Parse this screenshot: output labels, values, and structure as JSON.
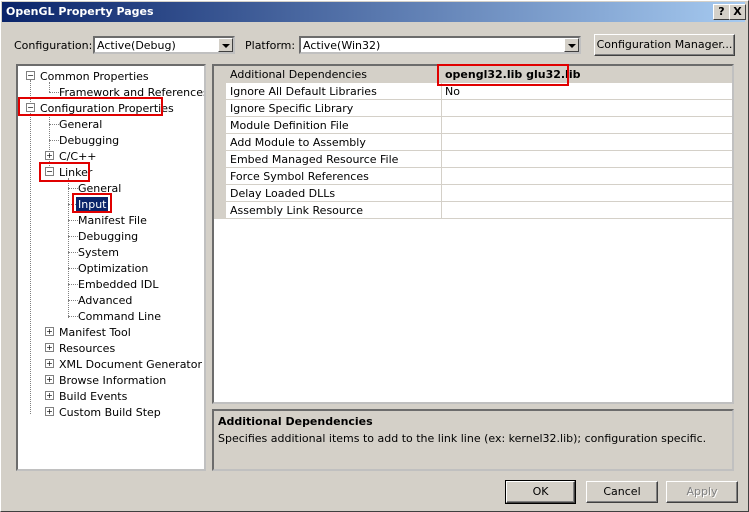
{
  "window": {
    "title": "OpenGL Property Pages"
  },
  "titlebar_buttons": {
    "help": "?",
    "close": "X"
  },
  "config": {
    "configuration_label": "Configuration:",
    "configuration_value": "Active(Debug)",
    "platform_label": "Platform:",
    "platform_value": "Active(Win32)",
    "manager_button": "Configuration Manager..."
  },
  "tree": {
    "common_properties": "Common Properties",
    "framework_references": "Framework and References",
    "configuration_properties": "Configuration Properties",
    "general": "General",
    "debugging": "Debugging",
    "cpp": "C/C++",
    "linker": "Linker",
    "linker_children": [
      "General",
      "Input",
      "Manifest File",
      "Debugging",
      "System",
      "Optimization",
      "Embedded IDL",
      "Advanced",
      "Command Line"
    ],
    "after_linker": [
      "Manifest Tool",
      "Resources",
      "XML Document Generator",
      "Browse Information",
      "Build Events",
      "Custom Build Step"
    ]
  },
  "properties": [
    {
      "name": "Additional Dependencies",
      "value": "opengl32.lib glu32.lib"
    },
    {
      "name": "Ignore All Default Libraries",
      "value": "No"
    },
    {
      "name": "Ignore Specific Library",
      "value": ""
    },
    {
      "name": "Module Definition File",
      "value": ""
    },
    {
      "name": "Add Module to Assembly",
      "value": ""
    },
    {
      "name": "Embed Managed Resource File",
      "value": ""
    },
    {
      "name": "Force Symbol References",
      "value": ""
    },
    {
      "name": "Delay Loaded DLLs",
      "value": ""
    },
    {
      "name": "Assembly Link Resource",
      "value": ""
    }
  ],
  "description": {
    "title": "Additional Dependencies",
    "text": "Specifies additional items to add to the link line (ex: kernel32.lib); configuration specific."
  },
  "buttons": {
    "ok": "OK",
    "cancel": "Cancel",
    "apply": "Apply"
  },
  "colors": {
    "highlight": "#0a246a",
    "annotation_red": "#e00000",
    "face": "#d4d0c8"
  }
}
